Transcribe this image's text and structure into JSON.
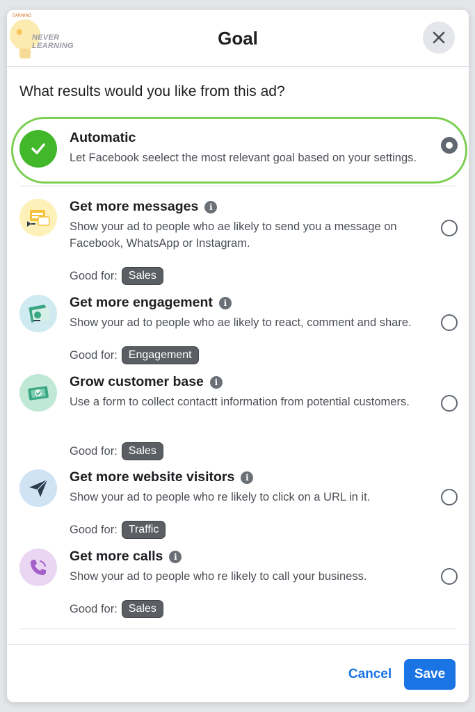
{
  "watermark": {
    "line1": "NEVER",
    "line2": "LEARNING"
  },
  "dialog": {
    "title": "Goal",
    "question": "What results would you like from this ad?"
  },
  "options": [
    {
      "title": "Automatic",
      "description": "Let Facebook seelect the most relevant goal based on your settings.",
      "selected": true,
      "icon": "green-check-icon",
      "icon_bg": "#42b72a"
    },
    {
      "title": "Get more messages",
      "description": "Show your ad to people who ae likely to send you a message on Facebook, WhatsApp or Instagram.",
      "good_for_label": "Good for:",
      "tag": "Sales",
      "icon": "messages-icon",
      "icon_bg": "#fdf0b8"
    },
    {
      "title": "Get more engagement",
      "description": "Show your ad to people who ae likely to react, comment and share.",
      "good_for_label": "Good for:",
      "tag": "Engagement",
      "icon": "engagement-icon",
      "icon_bg": "#cfeaf0"
    },
    {
      "title": "Grow customer base",
      "description": "Use a form to collect contactt information from potential customers.",
      "good_for_label": "Good for:",
      "tag": "Sales",
      "icon": "customer-base-icon",
      "icon_bg": "#bfe8d6"
    },
    {
      "title": "Get more website visitors",
      "description": "Show your ad to people who re likely to click on a URL in it.",
      "good_for_label": "Good for:",
      "tag": "Traffic",
      "icon": "paper-plane-icon",
      "icon_bg": "#cfe3f5"
    },
    {
      "title": "Get more calls",
      "description": "Show your ad to people who re likely to call your business.",
      "good_for_label": "Good for:",
      "tag": "Sales",
      "icon": "phone-icon",
      "icon_bg": "#ead6f3"
    }
  ],
  "footer": {
    "cancel_label": "Cancel",
    "save_label": "Save"
  },
  "colors": {
    "accent": "#1b74e4",
    "highlight": "#7ccf52",
    "tag_bg": "#5b5e63"
  }
}
